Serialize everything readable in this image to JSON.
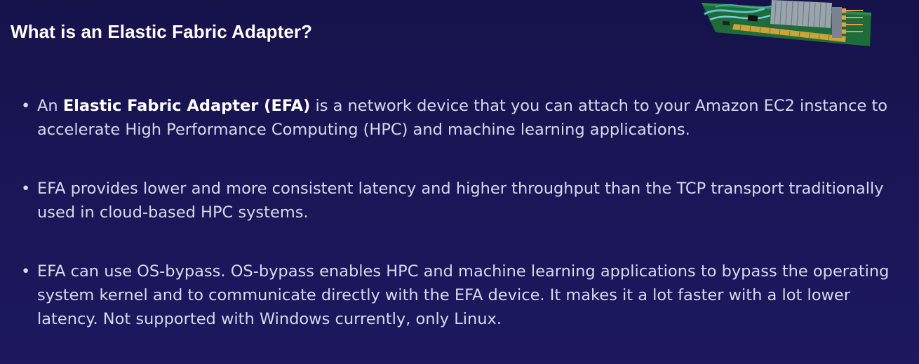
{
  "slide": {
    "title": "What is an Elastic Fabric Adapter?",
    "image_icon": "efa-network-card-photo"
  },
  "bullets": [
    {
      "prefix": "An ",
      "bold": "Elastic Fabric Adapter (EFA)",
      "suffix": " is a network device that you can attach to your Amazon EC2 instance to accelerate High Performance Computing (HPC) and machine learning applications."
    },
    {
      "text": "EFA provides lower and more consistent latency and higher throughput than the TCP transport traditionally used in cloud-based HPC systems."
    },
    {
      "text": "EFA can use OS-bypass. OS-bypass enables HPC and machine learning applications to bypass the operating system kernel and to communicate directly with the EFA device. It makes it a lot faster with a lot lower latency. Not supported with Windows currently, only Linux."
    }
  ],
  "colors": {
    "background_top": "#16124a",
    "background_bottom": "#1d185f",
    "title": "#ffffff",
    "body_text": "#d6d9ec"
  }
}
